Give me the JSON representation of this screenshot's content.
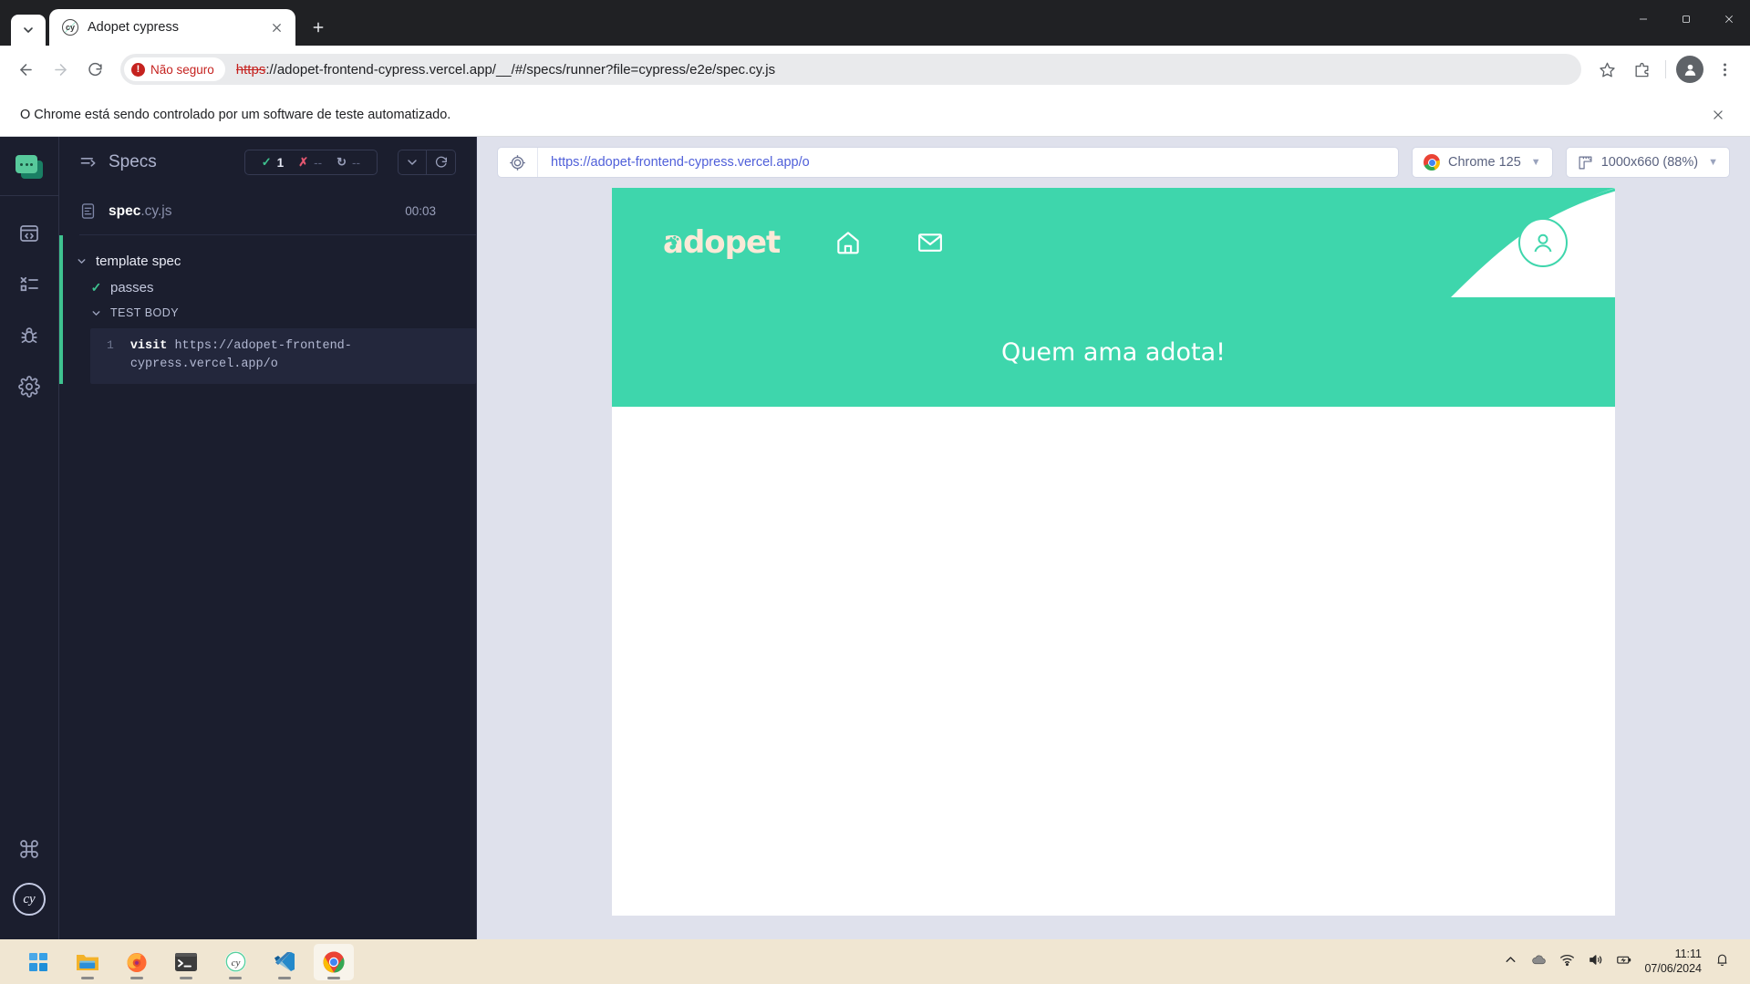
{
  "browser": {
    "tab": {
      "title": "Adopet cypress",
      "favicon": "cypress-icon"
    },
    "new_tab_label": "+",
    "window_controls": [
      "minimize",
      "maximize",
      "close"
    ],
    "nav": {
      "back": "back-icon",
      "forward": "forward-icon",
      "reload": "reload-icon"
    },
    "omnibox": {
      "security_label": "Não seguro",
      "url_scheme": "https",
      "url_rest": "://adopet-frontend-cypress.vercel.app/__/#/specs/runner?file=cypress/e2e/spec.cy.js",
      "full_url": "https://adopet-frontend-cypress.vercel.app/__/#/specs/runner?file=cypress/e2e/spec.cy.js",
      "bookmark": "star-icon",
      "extensions": "extensions-icon",
      "profile": "profile-icon",
      "menu": "kebab-menu-icon"
    },
    "infobar": {
      "message": "O Chrome está sendo controlado por um software de teste automatizado.",
      "close": "close-icon"
    }
  },
  "cypress": {
    "rail": {
      "project_icon": "project-window-icon",
      "items": [
        "specs-code-icon",
        "runs-list-icon",
        "debug-bug-icon",
        "settings-gear-icon"
      ],
      "logo": "cy"
    },
    "specs_panel": {
      "header_icon": "specs-list-icon",
      "title": "Specs",
      "stats": [
        {
          "icon": "check",
          "value": "1",
          "state": "passed"
        },
        {
          "icon": "cross",
          "value": "--",
          "state": "failed"
        },
        {
          "icon": "circle",
          "value": "--",
          "state": "pending"
        }
      ],
      "collapse_button": "chevron-down-icon",
      "rerun_button": "rerun-icon",
      "spec_file": {
        "name": "spec",
        "extension": ".cy.js",
        "duration": "00:03",
        "icon": "file-icon"
      },
      "tree": {
        "suite": "template spec",
        "test": "passes",
        "test_status": "passed",
        "body_label": "TEST BODY",
        "commands": [
          {
            "number": "1",
            "name": "visit",
            "arg": "https://adopet-frontend-cypress.vercel.app/o"
          }
        ]
      }
    },
    "runner": {
      "selector_icon": "selector-playground-icon",
      "url": "https://adopet-frontend-cypress.vercel.app/o",
      "browser_label": "Chrome 125",
      "browser_icon": "chrome-icon",
      "viewport_label": "1000x660 (88%)",
      "viewport_icon": "ruler-icon",
      "caret": "chevron-down-icon"
    }
  },
  "app_preview": {
    "brand": "adopet",
    "brand_mark": "paw-icon",
    "nav_items": [
      {
        "name": "home-icon"
      },
      {
        "name": "mail-icon"
      }
    ],
    "account_icon": "user-circle-icon",
    "hero_text": "Quem ama adota!",
    "colors": {
      "teal": "#3ed6ac",
      "cream": "#fbe9d7",
      "white": "#ffffff"
    }
  },
  "taskbar": {
    "items": [
      {
        "name": "start-button",
        "icon": "windows-logo"
      },
      {
        "name": "file-explorer",
        "icon": "folder-icon",
        "running": true
      },
      {
        "name": "firefox",
        "icon": "firefox-icon",
        "running": true
      },
      {
        "name": "terminal",
        "icon": "terminal-icon",
        "running": true
      },
      {
        "name": "cypress",
        "icon": "cypress-icon",
        "running": true
      },
      {
        "name": "vscode",
        "icon": "vscode-icon",
        "running": true
      },
      {
        "name": "chrome",
        "icon": "chrome-icon",
        "running": true,
        "active": true
      }
    ],
    "tray": [
      "chevron-up-icon",
      "cloud-icon",
      "wifi-icon",
      "volume-icon",
      "battery-icon"
    ],
    "clock": {
      "time": "11:11",
      "date": "07/06/2024"
    },
    "notifications": "bell-icon"
  }
}
